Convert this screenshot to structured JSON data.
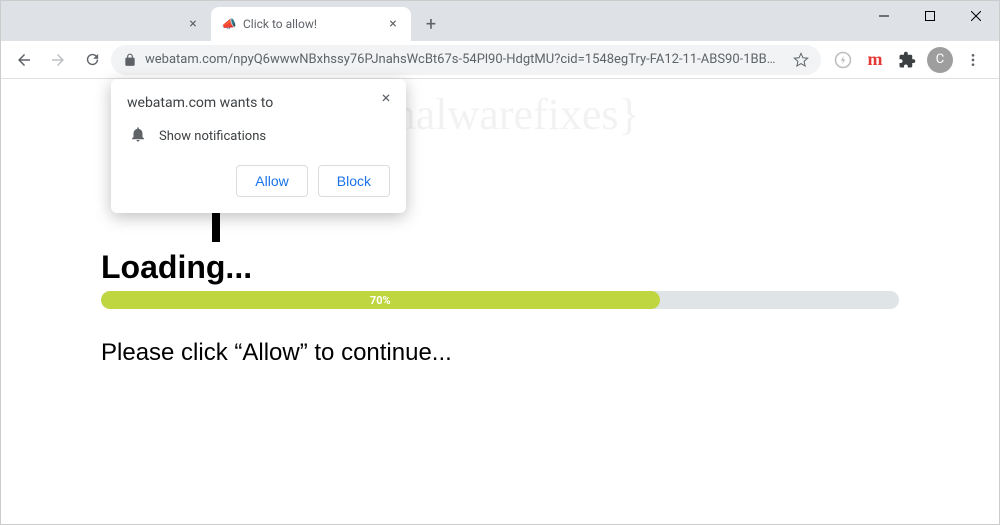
{
  "window": {
    "tabs": [
      {
        "title": "",
        "active": false
      },
      {
        "title": "Click to allow!",
        "active": true
      }
    ]
  },
  "toolbar": {
    "url": "webatam.com/npyQ6wwwNBxhssy76PJnahsWcBt67s-54Pl90-HdgtMU?cid=1548egTry-FA12-11-ABS90-1BB…"
  },
  "avatar": {
    "initial": "C"
  },
  "extensions": {
    "m_label": "m"
  },
  "permission": {
    "headline": "webatam.com wants to",
    "item": "Show notifications",
    "allow": "Allow",
    "block": "Block"
  },
  "page": {
    "loading": "Loading...",
    "progress_label": "70%",
    "progress_width": "70%",
    "instruction": "Please click “Allow” to continue...",
    "watermark": "{malwarefixes}"
  }
}
